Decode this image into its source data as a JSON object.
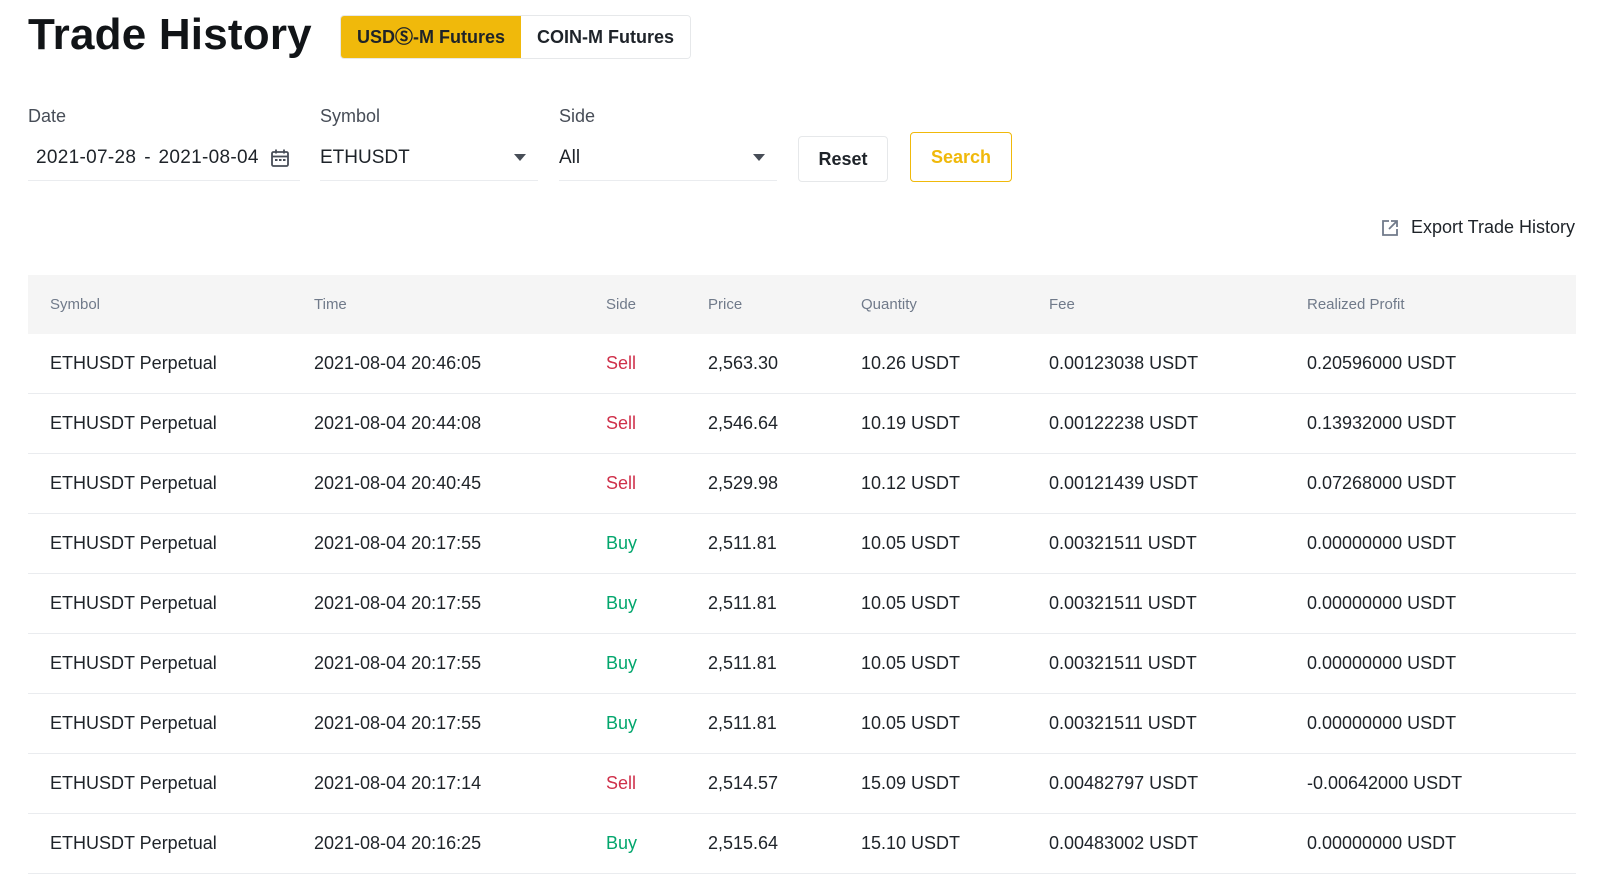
{
  "header": {
    "title": "Trade History",
    "tabs": [
      {
        "label": "USDⓈ-M Futures",
        "active": true
      },
      {
        "label": "COIN-M Futures",
        "active": false
      }
    ]
  },
  "filters": {
    "date": {
      "label": "Date",
      "start": "2021-07-28",
      "separator": "-",
      "end": "2021-08-04"
    },
    "symbol": {
      "label": "Symbol",
      "value": "ETHUSDT"
    },
    "side": {
      "label": "Side",
      "value": "All"
    },
    "reset_label": "Reset",
    "search_label": "Search"
  },
  "export_label": "Export Trade History",
  "colors": {
    "accent": "#f0b90b",
    "sell": "#cf304a",
    "buy": "#03a66d"
  },
  "table": {
    "columns": [
      "Symbol",
      "Time",
      "Side",
      "Price",
      "Quantity",
      "Fee",
      "Realized Profit"
    ],
    "rows": [
      {
        "symbol": "ETHUSDT Perpetual",
        "time": "2021-08-04 20:46:05",
        "side": "Sell",
        "price": "2,563.30",
        "quantity": "10.26 USDT",
        "fee": "0.00123038 USDT",
        "profit": "0.20596000 USDT"
      },
      {
        "symbol": "ETHUSDT Perpetual",
        "time": "2021-08-04 20:44:08",
        "side": "Sell",
        "price": "2,546.64",
        "quantity": "10.19 USDT",
        "fee": "0.00122238 USDT",
        "profit": "0.13932000 USDT"
      },
      {
        "symbol": "ETHUSDT Perpetual",
        "time": "2021-08-04 20:40:45",
        "side": "Sell",
        "price": "2,529.98",
        "quantity": "10.12 USDT",
        "fee": "0.00121439 USDT",
        "profit": "0.07268000 USDT"
      },
      {
        "symbol": "ETHUSDT Perpetual",
        "time": "2021-08-04 20:17:55",
        "side": "Buy",
        "price": "2,511.81",
        "quantity": "10.05 USDT",
        "fee": "0.00321511 USDT",
        "profit": "0.00000000 USDT"
      },
      {
        "symbol": "ETHUSDT Perpetual",
        "time": "2021-08-04 20:17:55",
        "side": "Buy",
        "price": "2,511.81",
        "quantity": "10.05 USDT",
        "fee": "0.00321511 USDT",
        "profit": "0.00000000 USDT"
      },
      {
        "symbol": "ETHUSDT Perpetual",
        "time": "2021-08-04 20:17:55",
        "side": "Buy",
        "price": "2,511.81",
        "quantity": "10.05 USDT",
        "fee": "0.00321511 USDT",
        "profit": "0.00000000 USDT"
      },
      {
        "symbol": "ETHUSDT Perpetual",
        "time": "2021-08-04 20:17:55",
        "side": "Buy",
        "price": "2,511.81",
        "quantity": "10.05 USDT",
        "fee": "0.00321511 USDT",
        "profit": "0.00000000 USDT"
      },
      {
        "symbol": "ETHUSDT Perpetual",
        "time": "2021-08-04 20:17:14",
        "side": "Sell",
        "price": "2,514.57",
        "quantity": "15.09 USDT",
        "fee": "0.00482797 USDT",
        "profit": "-0.00642000 USDT"
      },
      {
        "symbol": "ETHUSDT Perpetual",
        "time": "2021-08-04 20:16:25",
        "side": "Buy",
        "price": "2,515.64",
        "quantity": "15.10 USDT",
        "fee": "0.00483002 USDT",
        "profit": "0.00000000 USDT"
      }
    ]
  }
}
